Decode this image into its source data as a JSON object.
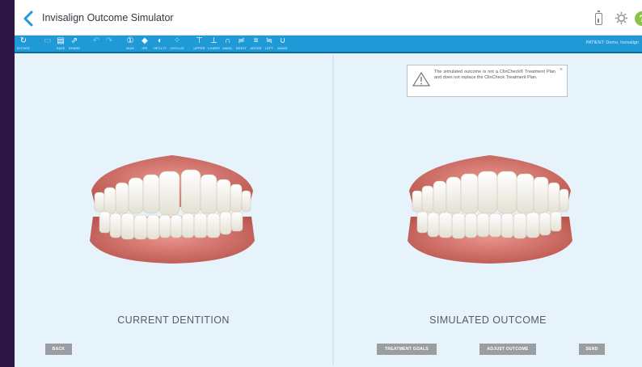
{
  "app": {
    "title": "Invisalign Outcome Simulator"
  },
  "toolbar": {
    "items": [
      {
        "label": "ROTATE",
        "icon": "rotate-icon",
        "glyph": "↻"
      },
      {
        "label": "",
        "icon": "folder-icon",
        "glyph": "▭"
      },
      {
        "label": "SAVE",
        "icon": "save-icon",
        "glyph": "▤"
      },
      {
        "label": "SHARE",
        "icon": "share-icon",
        "glyph": "⇗"
      },
      {
        "label": "",
        "icon": "undo-icon",
        "glyph": "↶"
      },
      {
        "label": "",
        "icon": "redo-icon",
        "glyph": "↷"
      },
      {
        "label": "NUM",
        "icon": "numbering-icon",
        "glyph": "①"
      },
      {
        "label": "IPR",
        "icon": "ipr-icon",
        "glyph": "◆"
      },
      {
        "label": "OPCLTY",
        "icon": "opacity-icon",
        "glyph": "◐"
      },
      {
        "label": "OCCLUS",
        "icon": "occlusion-icon",
        "glyph": "⁘"
      },
      {
        "label": "UPPER",
        "icon": "upper-jaw-icon",
        "glyph": "⊤"
      },
      {
        "label": "LOWER",
        "icon": "lower-jaw-icon",
        "glyph": "⊥"
      },
      {
        "label": "MAXIL",
        "icon": "maxillary-icon",
        "glyph": "∩"
      },
      {
        "label": "RIGHT",
        "icon": "right-view-icon",
        "glyph": "≓"
      },
      {
        "label": "ANTER",
        "icon": "anterior-view-icon",
        "glyph": "≡"
      },
      {
        "label": "LEFT",
        "icon": "left-view-icon",
        "glyph": "≒"
      },
      {
        "label": "MAND",
        "icon": "mandibular-icon",
        "glyph": "∪"
      }
    ],
    "patient": "PATIENT: Demo, Invisalign"
  },
  "left_panel": {
    "title": "CURRENT DENTITION",
    "back_label": "BACK"
  },
  "right_panel": {
    "title": "SIMULATED OUTCOME",
    "notice": "The simulated outcome is not a ClinCheck® Treatment Plan and does not replace the ClinCheck Treatment Plan.",
    "notice_close": "×",
    "buttons": {
      "treatment_goals": "TREATMENT GOALS",
      "adjust_outcome": "ADJUST OUTCOME",
      "send": "SEND"
    }
  },
  "colors": {
    "accent": "#1f9ad6",
    "background": "#e6f3fb",
    "gum": "#d9776e",
    "tooth": "#f4f1e8",
    "button": "#9b9ea1",
    "help": "#8bc34a"
  }
}
